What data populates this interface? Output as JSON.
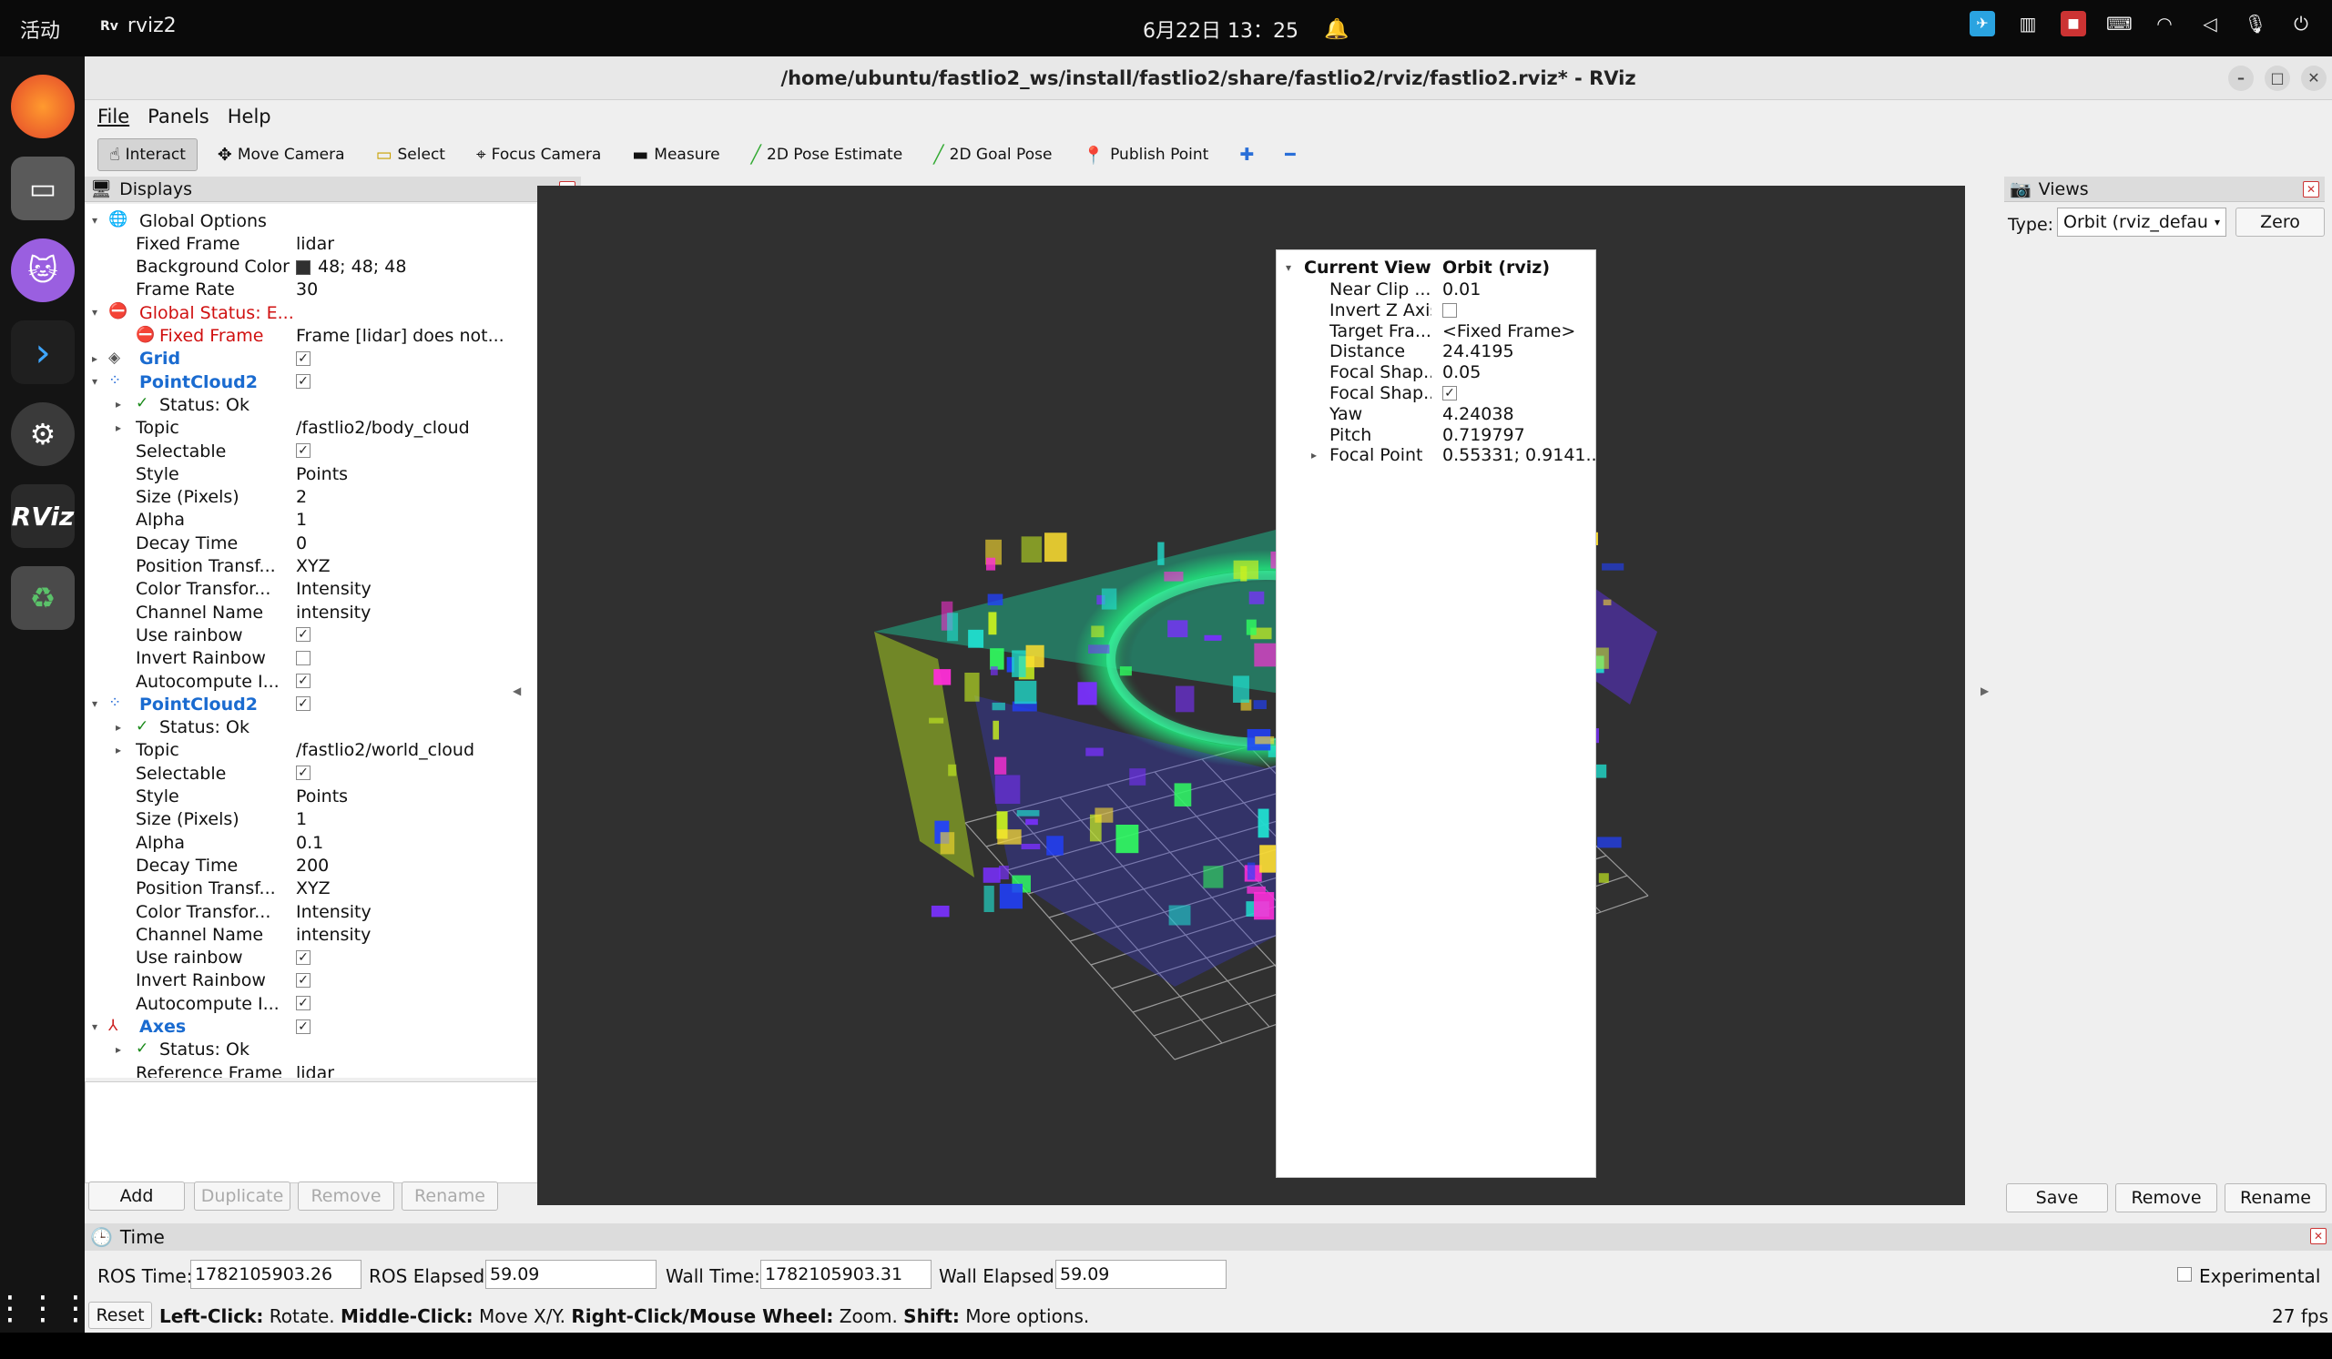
{
  "os": {
    "activities": "活动",
    "app_name": "rviz2",
    "clock": "6月22日  13：25",
    "tray_icons": [
      "telegram-icon",
      "network-monitor-icon",
      "app-indicator-icon",
      "keyboard-icon",
      "wifi-icon",
      "volume-icon",
      "microphone-icon",
      "power-icon"
    ],
    "dock": [
      "firefox-icon",
      "files-icon",
      "cat-app-icon",
      "vscode-icon",
      "settings-icon",
      "rviz-icon",
      "trash-icon",
      "app-grid-icon"
    ]
  },
  "window": {
    "title": "/home/ubuntu/fastlio2_ws/install/fastlio2/share/fastlio2/rviz/fastlio2.rviz* - RViz"
  },
  "menu": [
    "File",
    "Panels",
    "Help"
  ],
  "toolbar": {
    "interact": "Interact",
    "move_camera": "Move Camera",
    "select": "Select",
    "focus_camera": "Focus Camera",
    "measure": "Measure",
    "pose_estimate": "2D Pose Estimate",
    "goal_pose": "2D Goal Pose",
    "publish_point": "Publish Point"
  },
  "displays": {
    "title": "Displays",
    "rows": [
      {
        "key": "Global Options",
        "val": "",
        "level": 0,
        "arrow": "▾",
        "icon": "globe",
        "cls": ""
      },
      {
        "key": "Fixed Frame",
        "val": "lidar",
        "level": 1
      },
      {
        "key": "Background Color",
        "val": "48; 48; 48",
        "level": 1,
        "swatch": "#303030"
      },
      {
        "key": "Frame Rate",
        "val": "30",
        "level": 1
      },
      {
        "key": "Global Status: E...",
        "val": "",
        "level": 0,
        "arrow": "▾",
        "icon": "error",
        "cls": "red"
      },
      {
        "key": "Fixed Frame",
        "val": "Frame [lidar] does not...",
        "level": 1,
        "icon": "error",
        "cls": "red"
      },
      {
        "key": "Grid",
        "val": "",
        "level": 0,
        "arrow": "▸",
        "icon": "grid",
        "cls": "blue",
        "check": true
      },
      {
        "key": "PointCloud2",
        "val": "",
        "level": 0,
        "arrow": "▾",
        "icon": "cloud",
        "cls": "blue",
        "check": true
      },
      {
        "key": "Status: Ok",
        "val": "",
        "level": 1,
        "arrow": "▸",
        "icon": "ok"
      },
      {
        "key": "Topic",
        "val": "/fastlio2/body_cloud",
        "level": 1,
        "arrow": "▸"
      },
      {
        "key": "Selectable",
        "val": "",
        "level": 1,
        "check": true
      },
      {
        "key": "Style",
        "val": "Points",
        "level": 1
      },
      {
        "key": "Size (Pixels)",
        "val": "2",
        "level": 1
      },
      {
        "key": "Alpha",
        "val": "1",
        "level": 1
      },
      {
        "key": "Decay Time",
        "val": "0",
        "level": 1
      },
      {
        "key": "Position Transf...",
        "val": "XYZ",
        "level": 1
      },
      {
        "key": "Color Transfor...",
        "val": "Intensity",
        "level": 1
      },
      {
        "key": "Channel Name",
        "val": "intensity",
        "level": 1
      },
      {
        "key": "Use rainbow",
        "val": "",
        "level": 1,
        "check": true
      },
      {
        "key": "Invert Rainbow",
        "val": "",
        "level": 1,
        "check": false
      },
      {
        "key": "Autocompute I...",
        "val": "",
        "level": 1,
        "check": true
      },
      {
        "key": "PointCloud2",
        "val": "",
        "level": 0,
        "arrow": "▾",
        "icon": "cloud",
        "cls": "blue",
        "check": true
      },
      {
        "key": "Status: Ok",
        "val": "",
        "level": 1,
        "arrow": "▸",
        "icon": "ok"
      },
      {
        "key": "Topic",
        "val": "/fastlio2/world_cloud",
        "level": 1,
        "arrow": "▸"
      },
      {
        "key": "Selectable",
        "val": "",
        "level": 1,
        "check": true
      },
      {
        "key": "Style",
        "val": "Points",
        "level": 1
      },
      {
        "key": "Size (Pixels)",
        "val": "1",
        "level": 1
      },
      {
        "key": "Alpha",
        "val": "0.1",
        "level": 1
      },
      {
        "key": "Decay Time",
        "val": "200",
        "level": 1
      },
      {
        "key": "Position Transf...",
        "val": "XYZ",
        "level": 1
      },
      {
        "key": "Color Transfor...",
        "val": "Intensity",
        "level": 1
      },
      {
        "key": "Channel Name",
        "val": "intensity",
        "level": 1
      },
      {
        "key": "Use rainbow",
        "val": "",
        "level": 1,
        "check": true
      },
      {
        "key": "Invert Rainbow",
        "val": "",
        "level": 1,
        "check": true
      },
      {
        "key": "Autocompute I...",
        "val": "",
        "level": 1,
        "check": true
      },
      {
        "key": "Axes",
        "val": "",
        "level": 0,
        "arrow": "▾",
        "icon": "axes",
        "cls": "blue",
        "check": true
      },
      {
        "key": "Status: Ok",
        "val": "",
        "level": 1,
        "arrow": "▸",
        "icon": "ok"
      },
      {
        "key": "Reference Frame",
        "val": "lidar",
        "level": 1
      }
    ],
    "buttons": {
      "add": "Add",
      "duplicate": "Duplicate",
      "remove": "Remove",
      "rename": "Rename"
    }
  },
  "views": {
    "title": "Views",
    "type_label": "Type:",
    "type_value": "Orbit (rviz_defau",
    "zero": "Zero",
    "current_view": "Current View",
    "current_type": "Orbit (rviz)",
    "rows": [
      {
        "key": "Near Clip ...",
        "val": "0.01"
      },
      {
        "key": "Invert Z Axis",
        "val": "",
        "check": false
      },
      {
        "key": "Target Fra...",
        "val": "<Fixed Frame>"
      },
      {
        "key": "Distance",
        "val": "24.4195"
      },
      {
        "key": "Focal Shap...",
        "val": "0.05"
      },
      {
        "key": "Focal Shap...",
        "val": "",
        "check": true
      },
      {
        "key": "Yaw",
        "val": "4.24038"
      },
      {
        "key": "Pitch",
        "val": "0.719797"
      },
      {
        "key": "Focal Point",
        "val": "0.55331; 0.9141...",
        "arrow": true
      }
    ],
    "buttons": {
      "save": "Save",
      "remove": "Remove",
      "rename": "Rename"
    }
  },
  "time": {
    "title": "Time",
    "ros_time_label": "ROS Time:",
    "ros_time": "1782105903.26",
    "ros_elapsed_label": "ROS Elapsed:",
    "ros_elapsed": "59.09",
    "wall_time_label": "Wall Time:",
    "wall_time": "1782105903.31",
    "wall_elapsed_label": "Wall Elapsed:",
    "wall_elapsed": "59.09",
    "experimental": "Experimental"
  },
  "status": {
    "reset": "Reset",
    "b1": "Left-Click:",
    "t1": "Rotate.",
    "b2": "Middle-Click:",
    "t2": "Move X/Y.",
    "b3": "Right-Click/Mouse Wheel:",
    "t3": "Zoom.",
    "b4": "Shift:",
    "t4": "More options.",
    "fps": "27 fps"
  },
  "colors": {
    "viewport_bg": "#303030",
    "accent_blue": "#1a6bd0",
    "error_red": "#d01010"
  }
}
